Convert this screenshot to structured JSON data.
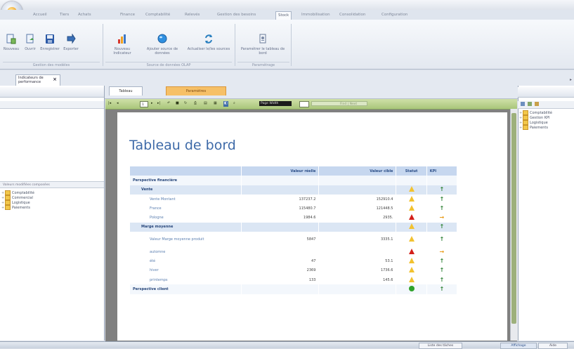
{
  "app": {
    "ribbon_tabs": [
      "Accueil",
      "Tiers",
      "Achats",
      "Finance",
      "Comptabilité",
      "Relevés",
      "Gestion des besoins",
      "Stock",
      "Immobilisation",
      "Consolidation",
      "Configuration"
    ],
    "active_tab_index": 7
  },
  "ribbon": {
    "buttons": [
      {
        "label": "Nouveau",
        "icon": "new-document-icon"
      },
      {
        "label": "Ouvrir",
        "icon": "open-document-icon"
      },
      {
        "label": "Enregistrer",
        "icon": "save-icon"
      },
      {
        "label": "Exporter",
        "icon": "export-icon"
      },
      {
        "label": "Nouveau Indicateur",
        "icon": "bar-chart-icon"
      },
      {
        "label": "Ajouter source de données",
        "icon": "globe-icon"
      },
      {
        "label": "Actualiser le/les sources",
        "icon": "refresh-icon"
      },
      {
        "label": "Paramétrer le tableau de bord",
        "icon": "settings-doc-icon"
      }
    ],
    "groups": [
      "Gestion des modèles",
      "Source de données OLAP",
      "Paramétrage"
    ]
  },
  "document_tab": {
    "label": "Indicateurs de performance"
  },
  "left_panel": {
    "split_label": "Valeurs modifiées composées",
    "tree": [
      {
        "label": "Comptabilité",
        "expand": "+"
      },
      {
        "label": "Commercial",
        "expand": "+"
      },
      {
        "label": "Logistique",
        "expand": "+"
      },
      {
        "label": "Paiements",
        "expand": "+"
      }
    ]
  },
  "right_panel": {
    "tree": [
      {
        "label": "Comptabilité",
        "expand": "+"
      },
      {
        "label": "Gestion KPI",
        "expand": "+"
      },
      {
        "label": "Logistique",
        "expand": "+"
      },
      {
        "label": "Paiements",
        "expand": "+"
      }
    ]
  },
  "center_tabs": {
    "tableau": "Tableau",
    "parametres": "Paramètres"
  },
  "viewer": {
    "page": "1",
    "zoom": "Page Width",
    "find": "Find | Next"
  },
  "report": {
    "title": "Tableau de bord",
    "columns": [
      "Valeur réelle",
      "Valeur cible",
      "Statut",
      "KPI"
    ],
    "rows": [
      {
        "type": "sec",
        "label": "Perspective financière",
        "actual": "",
        "target": "",
        "status": "",
        "kpi": ""
      },
      {
        "type": "grp",
        "label": "Vente",
        "actual": "",
        "target": "",
        "status": "yellow",
        "kpi": "up"
      },
      {
        "type": "item",
        "label": "Vente Montant",
        "actual": "137237.2",
        "target": "152910.4",
        "status": "yellow",
        "kpi": "up"
      },
      {
        "type": "item",
        "label": "France",
        "actual": "115480.7",
        "target": "121448.5",
        "status": "yellow",
        "kpi": "up"
      },
      {
        "type": "item",
        "label": "Pologne",
        "actual": "1984.6",
        "target": "2935.",
        "status": "red",
        "kpi": "right"
      },
      {
        "type": "grp",
        "label": "Marge moyenne",
        "actual": "",
        "target": "",
        "status": "yellow",
        "kpi": "up"
      },
      {
        "type": "item tall",
        "label": "Valeur Marge moyenne produit",
        "actual": "5847",
        "target": "3335.1",
        "status": "yellow",
        "kpi": "up"
      },
      {
        "type": "item",
        "label": "automne",
        "actual": "",
        "target": "",
        "status": "red",
        "kpi": "right"
      },
      {
        "type": "item",
        "label": "été",
        "actual": "47",
        "target": "53.1",
        "status": "yellow",
        "kpi": "up"
      },
      {
        "type": "item",
        "label": "hiver",
        "actual": "2369",
        "target": "1736.6",
        "status": "yellow",
        "kpi": "up"
      },
      {
        "type": "item",
        "label": "printemps",
        "actual": "133",
        "target": "145.6",
        "status": "yellow",
        "kpi": "up"
      },
      {
        "type": "sec",
        "label": "Perspective client",
        "actual": "",
        "target": "",
        "status": "green",
        "kpi": "up"
      }
    ]
  },
  "statusbar": {
    "buttons": [
      "Liste des tâches",
      "Affichage",
      "Aide"
    ]
  }
}
